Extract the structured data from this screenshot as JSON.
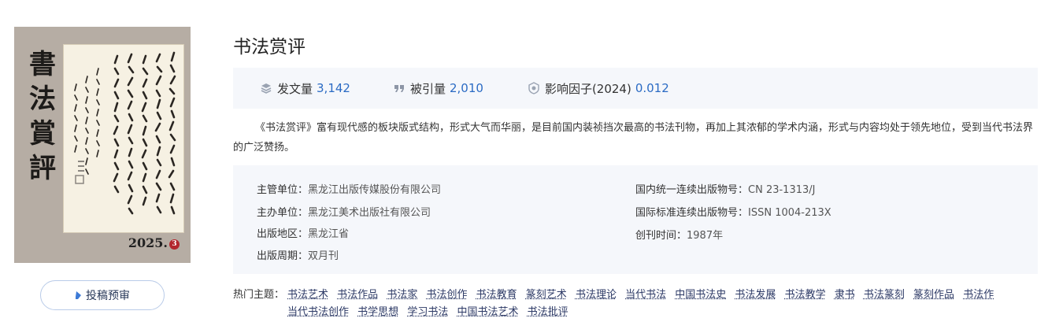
{
  "cover": {
    "title": "書法賞評",
    "issue_year": "2025.",
    "issue_no": "3"
  },
  "submit_button": {
    "label": "投稿预审"
  },
  "journal": {
    "title": "书法赏评"
  },
  "stats": [
    {
      "icon": "layers-icon",
      "label": "发文量",
      "value": "3,142"
    },
    {
      "icon": "quote-icon",
      "label": "被引量",
      "value": "2,010"
    },
    {
      "icon": "badge-icon",
      "label": "影响因子(2024)",
      "value": "0.012"
    }
  ],
  "description": "《书法赏评》富有现代感的板块版式结构，形式大气而华丽，是目前国内装祯挡次最高的书法刊物，再加上其浓郁的学术内涵，形式与内容均处于领先地位，受到当代书法界的广泛赞扬。",
  "info": {
    "left": [
      {
        "key": "主管单位：",
        "value": "黑龙江出版传媒股份有限公司"
      },
      {
        "key": "主办单位：",
        "value": "黑龙江美术出版社有限公司"
      },
      {
        "key": "出版地区：",
        "value": "黑龙江省"
      },
      {
        "key": "出版周期：",
        "value": "双月刊"
      }
    ],
    "right": [
      {
        "key": "国内统一连续出版物号：",
        "value": "CN 23-1313/J"
      },
      {
        "key": "国际标准连续出版物号：",
        "value": "ISSN 1004-213X"
      },
      {
        "key": "创刊时间：",
        "value": "1987年"
      }
    ]
  },
  "topics": {
    "label": "热门主题：",
    "items": [
      "书法艺术",
      "书法作品",
      "书法家",
      "书法创作",
      "书法教育",
      "篆刻艺术",
      "书法理论",
      "当代书法",
      "中国书法史",
      "书法发展",
      "书法教学",
      "隶书",
      "书法篆刻",
      "篆刻作品",
      "书法作",
      "当代书法创作",
      "书学思想",
      "学习书法",
      "中国书法艺术",
      "书法批评"
    ]
  },
  "colors": {
    "accent": "#2b6bc4",
    "panel_bg": "#f5f7fb",
    "topic_link": "#2d3a66"
  }
}
